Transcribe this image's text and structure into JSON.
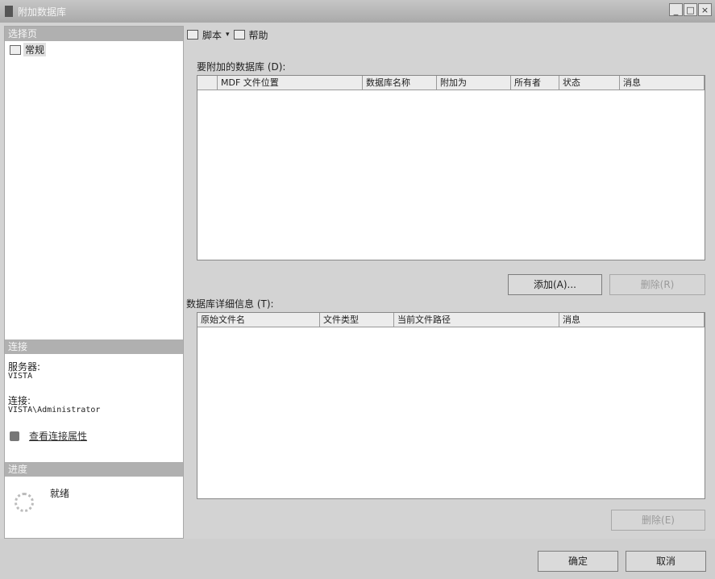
{
  "window": {
    "title": "附加数据库",
    "minimize": "_",
    "maximize": "□",
    "close": "×"
  },
  "left": {
    "select_page_header": "选择页",
    "pages": [
      {
        "label": "常规"
      }
    ],
    "connection_header": "连接",
    "server_label": "服务器:",
    "server_value": "VISTA",
    "connection_label": "连接:",
    "connection_value": "VISTA\\Administrator",
    "view_props_link": "查看连接属性",
    "progress_header": "进度",
    "status_text": "就绪"
  },
  "toolbar": {
    "script_label": "脚本",
    "dropdown_arrow": "▾",
    "help_label": "帮助"
  },
  "attach": {
    "group_label": "要附加的数据库 (D):",
    "columns": [
      "",
      "MDF 文件位置",
      "数据库名称",
      "附加为",
      "所有者",
      "状态",
      "消息"
    ],
    "add_button": "添加(A)...",
    "remove_button": "删除(R)"
  },
  "details": {
    "group_label": "数据库详细信息 (T):",
    "columns": [
      "原始文件名",
      "文件类型",
      "当前文件路径",
      "消息"
    ],
    "remove_button": "删除(E)"
  },
  "footer": {
    "ok_button": "确定",
    "cancel_button": "取消"
  }
}
